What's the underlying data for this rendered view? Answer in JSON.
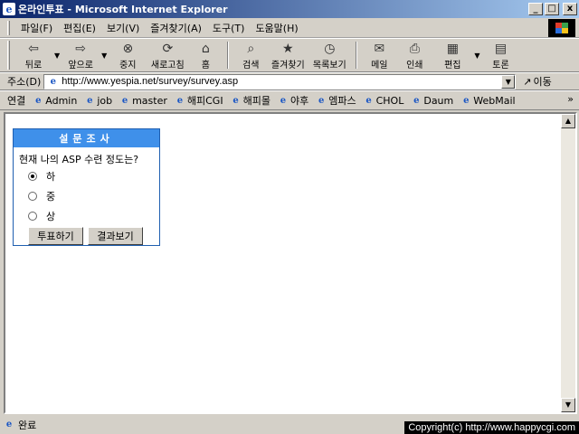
{
  "window": {
    "title": "온라인투표 - Microsoft Internet Explorer",
    "app_icon": "e",
    "buttons": [
      "_",
      "□",
      "x"
    ]
  },
  "menu": [
    "파일(F)",
    "편집(E)",
    "보기(V)",
    "즐겨찾기(A)",
    "도구(T)",
    "도움말(H)"
  ],
  "toolbar": {
    "back": "뒤로",
    "forward": "앞으로",
    "stop": "중지",
    "refresh": "새로고침",
    "home": "홈",
    "search": "검색",
    "favorites": "즐겨찾기",
    "history": "목록보기",
    "mail": "메일",
    "print": "인쇄",
    "edit": "편집",
    "discuss": "토론"
  },
  "address": {
    "label": "주소(D)",
    "url": "http://www.yespia.net/survey/survey.asp",
    "go": "이동"
  },
  "links": {
    "label": "연결",
    "items": [
      "Admin",
      "job",
      "master",
      "해피CGI",
      "해피몰",
      "야후",
      "엠파스",
      "CHOL",
      "Daum",
      "WebMail"
    ]
  },
  "survey": {
    "title": "설문조사",
    "question": "현재 나의 ASP 수련 정도는?",
    "options": [
      "하",
      "중",
      "상"
    ],
    "selected": 0,
    "vote_button": "투표하기",
    "result_button": "결과보기"
  },
  "status": {
    "text": "완료"
  },
  "overlay": {
    "copyright": "Copyright(c) http://www.happycgi.com"
  }
}
